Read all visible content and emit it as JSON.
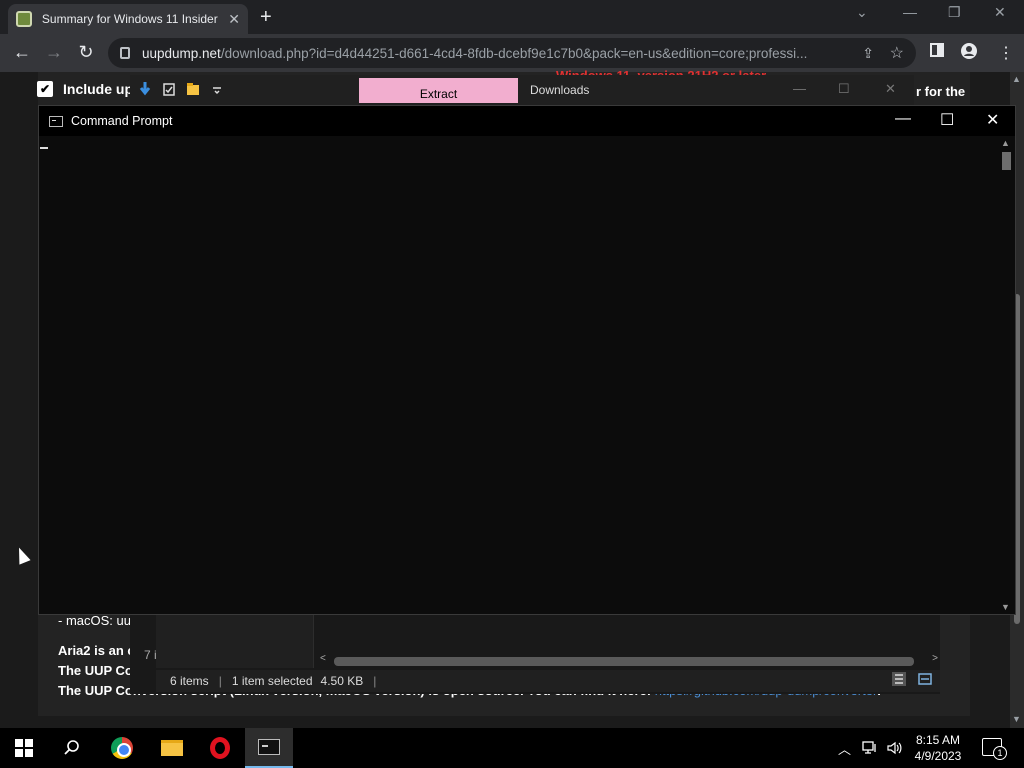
{
  "browser": {
    "tab_title": "Summary for Windows 11 Insider",
    "tab_close": "✕",
    "new_tab": "+",
    "url_host": "uupdump.net",
    "url_path": "/download.php?id=d4d44251-d661-4cd4-8fdb-dcebf9e1c7b0&pack=en-us&edition=core;professi...",
    "back": "←",
    "forward": "→",
    "reload": "↻",
    "share": "⇪",
    "star": "☆",
    "menu": "⋮",
    "win_min": "—",
    "win_restore": "❐",
    "win_close": "✕",
    "tab_search": "⌄"
  },
  "webpage": {
    "checkbox_mark": "✔",
    "include_label": "Include upc",
    "red_note": "Windows 11, version 21H2 or later",
    "right_fragment": "r for the",
    "macos_line": "- macOS: uu",
    "aria_line": "Aria2 is an c",
    "uup_line1": "The UUP Conve",
    "uup_line2_prefix": "The UUP Conversion script (Linux version, macOS version) is open source. You can find it here:",
    "uup_link": "https://github.com/uup-dump/converter",
    "uup_line2_suffix": "."
  },
  "explorer": {
    "tab_extract": "Extract",
    "tab_downloads": "Downloads",
    "min": "—",
    "max": "☐",
    "close": "✕",
    "side_count": "7 i",
    "status_items": "6 items",
    "status_selected": "1 item selected",
    "status_size": "4.50 KB"
  },
  "cmd": {
    "title": "Command Prompt",
    "min": "—",
    "max": "☐",
    "close": "✕"
  },
  "taskbar": {
    "search": "⌕",
    "tray_chevron": "︿",
    "tray_network": "🖧",
    "tray_volume": "🔊",
    "time": "8:15 AM",
    "date": "4/9/2023",
    "notif_count": "1"
  },
  "colors": {
    "accent": "#76b9ed",
    "extract_tab": "#f2aecf",
    "link": "#4b8fd6",
    "warning": "#e03131"
  }
}
